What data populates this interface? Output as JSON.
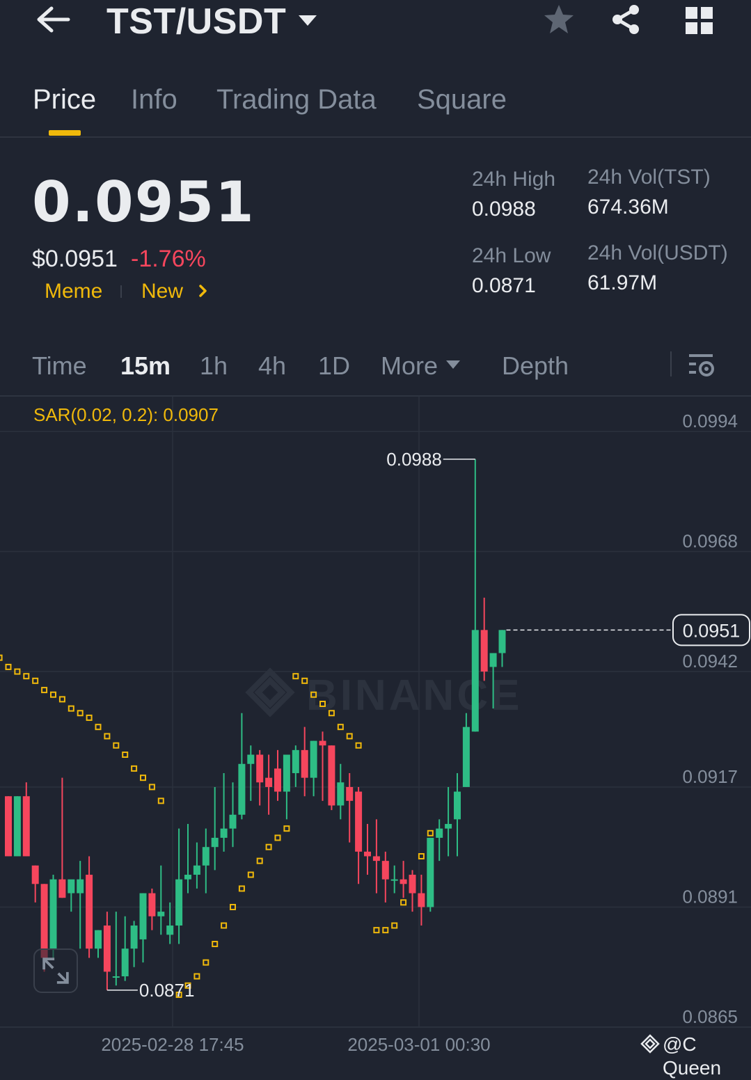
{
  "header": {
    "pair": "TST/USDT",
    "icons": {
      "back": "back-arrow-icon",
      "dropdown": "caret-down-icon",
      "favorite": "star-icon",
      "share": "share-icon",
      "menu": "grid-icon"
    }
  },
  "tabs": [
    {
      "label": "Price",
      "active": true
    },
    {
      "label": "Info",
      "active": false
    },
    {
      "label": "Trading Data",
      "active": false
    },
    {
      "label": "Square",
      "active": false
    }
  ],
  "ticker": {
    "last_price": "0.0951",
    "usd_price": "$0.0951",
    "change_pct": "-1.76%",
    "tags": [
      "Meme",
      "New"
    ],
    "stats": {
      "high_label": "24h High",
      "high_value": "0.0988",
      "low_label": "24h Low",
      "low_value": "0.0871",
      "vol_base_label": "24h Vol(TST)",
      "vol_base_value": "674.36M",
      "vol_quote_label": "24h Vol(USDT)",
      "vol_quote_value": "61.97M"
    }
  },
  "intervals": {
    "items": [
      "Time",
      "15m",
      "1h",
      "4h",
      "1D",
      "More",
      "Depth"
    ],
    "active": "15m"
  },
  "indicator": {
    "label": "SAR(0.02, 0.2): 0.0907"
  },
  "colors": {
    "up": "#2ebd85",
    "down": "#f6465d",
    "accent": "#f0b90b",
    "background": "#1f2430"
  },
  "chart_data": {
    "type": "candlestick",
    "y_ticks": [
      "0.0994",
      "0.0968",
      "0.0942",
      "0.0917",
      "0.0891",
      "0.0865"
    ],
    "y_tick_values": [
      0.0994,
      0.0968,
      0.0942,
      0.0917,
      0.0891,
      0.0865
    ],
    "ylim": [
      0.0865,
      0.0994
    ],
    "x_ticks": [
      "2025-02-28 17:45",
      "2025-03-01 00:30"
    ],
    "current_price_label": "0.0951",
    "high_marker": "0.0988",
    "low_marker": "0.0871",
    "watermark_text": "BINANCE",
    "candles": [
      {
        "o": 0.0915,
        "h": 0.0915,
        "l": 0.0902,
        "c": 0.0902
      },
      {
        "o": 0.0902,
        "h": 0.0915,
        "l": 0.0902,
        "c": 0.0915
      },
      {
        "o": 0.0915,
        "h": 0.0918,
        "l": 0.0902,
        "c": 0.0902
      },
      {
        "o": 0.09,
        "h": 0.09,
        "l": 0.0892,
        "c": 0.0896
      },
      {
        "o": 0.0896,
        "h": 0.0896,
        "l": 0.0877,
        "c": 0.088
      },
      {
        "o": 0.0882,
        "h": 0.0898,
        "l": 0.088,
        "c": 0.0897
      },
      {
        "o": 0.0897,
        "h": 0.0919,
        "l": 0.0893,
        "c": 0.0893
      },
      {
        "o": 0.0894,
        "h": 0.0896,
        "l": 0.089,
        "c": 0.0897
      },
      {
        "o": 0.0894,
        "h": 0.0901,
        "l": 0.0882,
        "c": 0.0897
      },
      {
        "o": 0.0898,
        "h": 0.0902,
        "l": 0.088,
        "c": 0.0882
      },
      {
        "o": 0.0882,
        "h": 0.0886,
        "l": 0.088,
        "c": 0.0886
      },
      {
        "o": 0.0887,
        "h": 0.089,
        "l": 0.0873,
        "c": 0.0877
      },
      {
        "o": 0.0876,
        "h": 0.089,
        "l": 0.0874,
        "c": 0.0876
      },
      {
        "o": 0.0876,
        "h": 0.0889,
        "l": 0.0875,
        "c": 0.0882
      },
      {
        "o": 0.0882,
        "h": 0.0888,
        "l": 0.0878,
        "c": 0.0887
      },
      {
        "o": 0.0884,
        "h": 0.0894,
        "l": 0.0879,
        "c": 0.0894
      },
      {
        "o": 0.0894,
        "h": 0.0895,
        "l": 0.0886,
        "c": 0.0889
      },
      {
        "o": 0.0889,
        "h": 0.09,
        "l": 0.0885,
        "c": 0.089
      },
      {
        "o": 0.0885,
        "h": 0.0892,
        "l": 0.0883,
        "c": 0.0887
      },
      {
        "o": 0.0887,
        "h": 0.0908,
        "l": 0.0883,
        "c": 0.0897
      },
      {
        "o": 0.0897,
        "h": 0.0909,
        "l": 0.0894,
        "c": 0.0898
      },
      {
        "o": 0.0898,
        "h": 0.0905,
        "l": 0.0895,
        "c": 0.09
      },
      {
        "o": 0.09,
        "h": 0.0908,
        "l": 0.0894,
        "c": 0.0904
      },
      {
        "o": 0.0904,
        "h": 0.0917,
        "l": 0.0899,
        "c": 0.0906
      },
      {
        "o": 0.0906,
        "h": 0.092,
        "l": 0.0903,
        "c": 0.0908
      },
      {
        "o": 0.0908,
        "h": 0.0918,
        "l": 0.0904,
        "c": 0.0911
      },
      {
        "o": 0.0911,
        "h": 0.0933,
        "l": 0.091,
        "c": 0.0922
      },
      {
        "o": 0.0922,
        "h": 0.0926,
        "l": 0.0914,
        "c": 0.0924
      },
      {
        "o": 0.0924,
        "h": 0.0925,
        "l": 0.0913,
        "c": 0.0918
      },
      {
        "o": 0.0919,
        "h": 0.0924,
        "l": 0.0911,
        "c": 0.0917
      },
      {
        "o": 0.0921,
        "h": 0.0925,
        "l": 0.0914,
        "c": 0.0916
      },
      {
        "o": 0.0916,
        "h": 0.0923,
        "l": 0.091,
        "c": 0.0924
      },
      {
        "o": 0.092,
        "h": 0.0926,
        "l": 0.0917,
        "c": 0.0925
      },
      {
        "o": 0.0925,
        "h": 0.093,
        "l": 0.0915,
        "c": 0.0919
      },
      {
        "o": 0.0919,
        "h": 0.0927,
        "l": 0.0915,
        "c": 0.0927
      },
      {
        "o": 0.0927,
        "h": 0.0929,
        "l": 0.0914,
        "c": 0.0926
      },
      {
        "o": 0.0926,
        "h": 0.0926,
        "l": 0.0912,
        "c": 0.0913
      },
      {
        "o": 0.0913,
        "h": 0.0922,
        "l": 0.091,
        "c": 0.0918
      },
      {
        "o": 0.0917,
        "h": 0.092,
        "l": 0.0905,
        "c": 0.0914
      },
      {
        "o": 0.0916,
        "h": 0.0917,
        "l": 0.0896,
        "c": 0.0903
      },
      {
        "o": 0.0903,
        "h": 0.0909,
        "l": 0.0898,
        "c": 0.0902
      },
      {
        "o": 0.0902,
        "h": 0.091,
        "l": 0.0894,
        "c": 0.0901
      },
      {
        "o": 0.0901,
        "h": 0.0903,
        "l": 0.0892,
        "c": 0.0897
      },
      {
        "o": 0.0897,
        "h": 0.09,
        "l": 0.0894,
        "c": 0.0897
      },
      {
        "o": 0.0897,
        "h": 0.0901,
        "l": 0.0893,
        "c": 0.0896
      },
      {
        "o": 0.0898,
        "h": 0.0899,
        "l": 0.089,
        "c": 0.0894
      },
      {
        "o": 0.0894,
        "h": 0.0898,
        "l": 0.0887,
        "c": 0.0891
      },
      {
        "o": 0.0891,
        "h": 0.0906,
        "l": 0.089,
        "c": 0.0906
      },
      {
        "o": 0.0906,
        "h": 0.091,
        "l": 0.0901,
        "c": 0.0908
      },
      {
        "o": 0.0908,
        "h": 0.0917,
        "l": 0.0902,
        "c": 0.0909
      },
      {
        "o": 0.091,
        "h": 0.092,
        "l": 0.0902,
        "c": 0.0916
      },
      {
        "o": 0.0917,
        "h": 0.0933,
        "l": 0.0917,
        "c": 0.093
      },
      {
        "o": 0.0929,
        "h": 0.0988,
        "l": 0.0929,
        "c": 0.0951
      },
      {
        "o": 0.0951,
        "h": 0.0958,
        "l": 0.094,
        "c": 0.0942
      },
      {
        "o": 0.0943,
        "h": 0.0946,
        "l": 0.0934,
        "c": 0.0946
      },
      {
        "o": 0.0946,
        "h": 0.0951,
        "l": 0.0943,
        "c": 0.0951
      }
    ],
    "sar": [
      {
        "i": -1,
        "v": 0.0945
      },
      {
        "i": 0,
        "v": 0.0943
      },
      {
        "i": 1,
        "v": 0.0942
      },
      {
        "i": 2,
        "v": 0.0941
      },
      {
        "i": 3,
        "v": 0.094
      },
      {
        "i": 4,
        "v": 0.0938
      },
      {
        "i": 5,
        "v": 0.0937
      },
      {
        "i": 6,
        "v": 0.0936
      },
      {
        "i": 7,
        "v": 0.0934
      },
      {
        "i": 8,
        "v": 0.0933
      },
      {
        "i": 9,
        "v": 0.0932
      },
      {
        "i": 10,
        "v": 0.093
      },
      {
        "i": 11,
        "v": 0.0928
      },
      {
        "i": 12,
        "v": 0.0926
      },
      {
        "i": 13,
        "v": 0.0924
      },
      {
        "i": 14,
        "v": 0.0921
      },
      {
        "i": 15,
        "v": 0.0919
      },
      {
        "i": 16,
        "v": 0.0917
      },
      {
        "i": 17,
        "v": 0.0914
      },
      {
        "i": 19,
        "v": 0.0872
      },
      {
        "i": 20,
        "v": 0.0874
      },
      {
        "i": 21,
        "v": 0.0876
      },
      {
        "i": 22,
        "v": 0.0879
      },
      {
        "i": 23,
        "v": 0.0883
      },
      {
        "i": 24,
        "v": 0.0887
      },
      {
        "i": 25,
        "v": 0.0891
      },
      {
        "i": 26,
        "v": 0.0895
      },
      {
        "i": 27,
        "v": 0.0898
      },
      {
        "i": 28,
        "v": 0.0901
      },
      {
        "i": 29,
        "v": 0.0904
      },
      {
        "i": 30,
        "v": 0.0906
      },
      {
        "i": 31,
        "v": 0.0908
      },
      {
        "i": 32,
        "v": 0.0941
      },
      {
        "i": 33,
        "v": 0.094
      },
      {
        "i": 34,
        "v": 0.0937
      },
      {
        "i": 35,
        "v": 0.0935
      },
      {
        "i": 36,
        "v": 0.0933
      },
      {
        "i": 37,
        "v": 0.093
      },
      {
        "i": 38,
        "v": 0.0928
      },
      {
        "i": 39,
        "v": 0.0926
      },
      {
        "i": 41,
        "v": 0.0886
      },
      {
        "i": 42,
        "v": 0.0886
      },
      {
        "i": 43,
        "v": 0.0887
      },
      {
        "i": 44,
        "v": 0.0892
      },
      {
        "i": 45,
        "v": 0.0897
      },
      {
        "i": 46,
        "v": 0.0902
      },
      {
        "i": 47,
        "v": 0.0907
      }
    ]
  },
  "watermark": {
    "handle": "@C Queen"
  }
}
